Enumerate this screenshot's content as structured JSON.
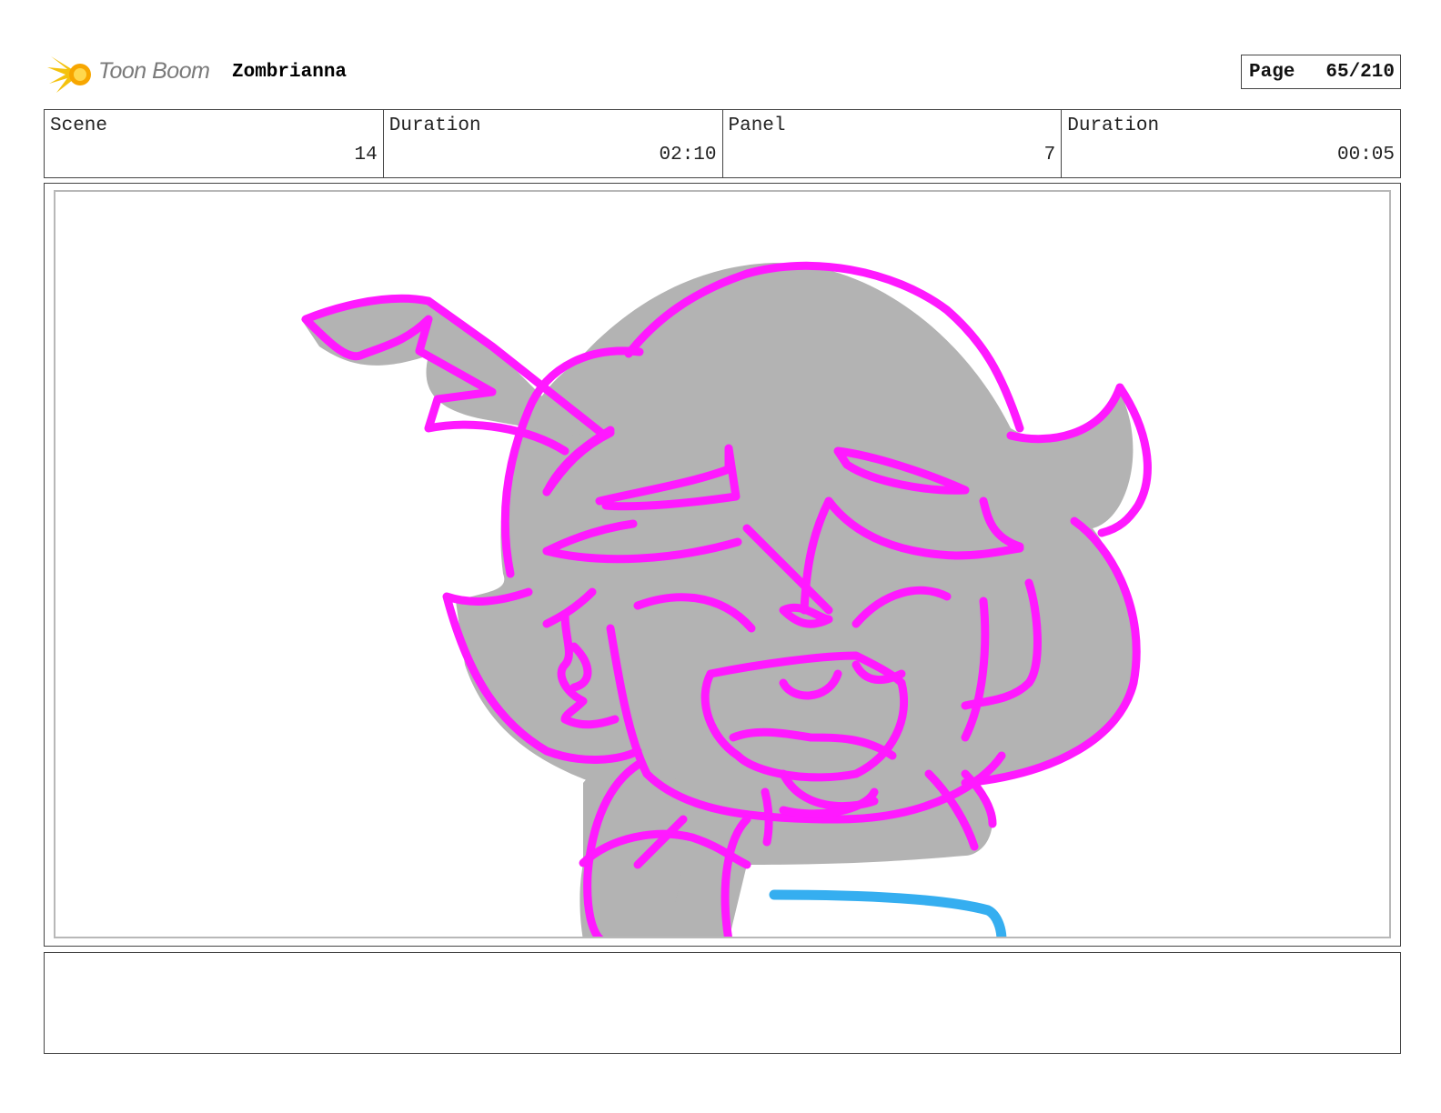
{
  "header": {
    "logo_text": "Toon Boom",
    "project_name": "Zombrianna",
    "page_label": "Page",
    "page_value": "65/210"
  },
  "info": [
    {
      "label": "Scene",
      "value": "14"
    },
    {
      "label": "Duration",
      "value": "02:10"
    },
    {
      "label": "Panel",
      "value": "7"
    },
    {
      "label": "Duration",
      "value": "00:05"
    }
  ],
  "panel": {
    "image": "sketch-crying-character-head",
    "colors": {
      "line": "#ff19ff",
      "fill": "#b3b3b3",
      "accent": "#35aef0"
    }
  },
  "notes": ""
}
